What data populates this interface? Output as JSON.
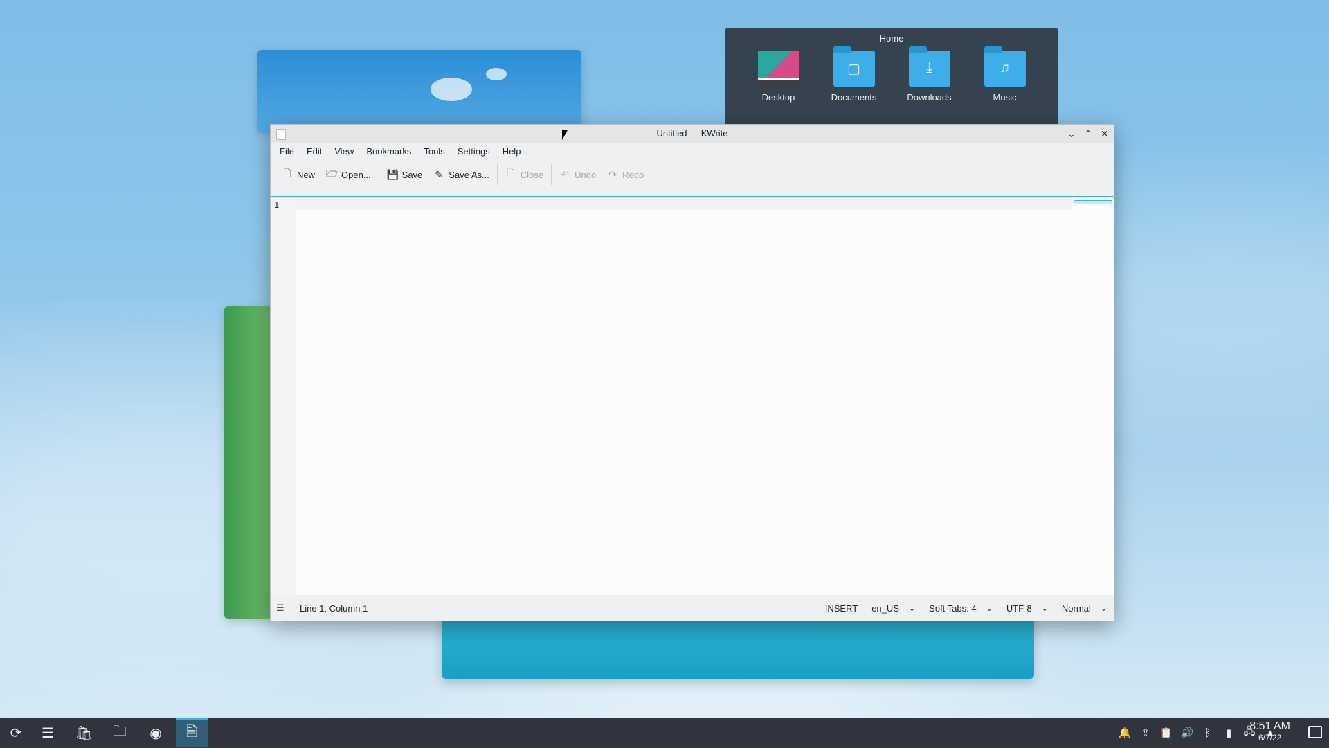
{
  "folderview": {
    "title": "Home",
    "items": [
      {
        "label": "Desktop",
        "icon": "desktop-folder-icon"
      },
      {
        "label": "Documents",
        "icon": "documents-folder-icon"
      },
      {
        "label": "Downloads",
        "icon": "downloads-folder-icon"
      },
      {
        "label": "Music",
        "icon": "music-folder-icon"
      }
    ]
  },
  "window": {
    "title": "Untitled — KWrite",
    "menus": [
      "File",
      "Edit",
      "View",
      "Bookmarks",
      "Tools",
      "Settings",
      "Help"
    ],
    "toolbar": {
      "new": "New",
      "open": "Open...",
      "save": "Save",
      "save_as": "Save As...",
      "close": "Close",
      "undo": "Undo",
      "redo": "Redo"
    },
    "editor": {
      "line_number": "1",
      "content": ""
    },
    "status": {
      "position": "Line 1, Column 1",
      "mode": "INSERT",
      "language": "en_US",
      "indent": "Soft Tabs: 4",
      "encoding": "UTF-8",
      "highlight": "Normal"
    }
  },
  "taskbar": {
    "time": "8:51 AM",
    "date": "6/7/22"
  },
  "colors": {
    "accent": "#3daee9",
    "taskbar": "#2f343f"
  }
}
